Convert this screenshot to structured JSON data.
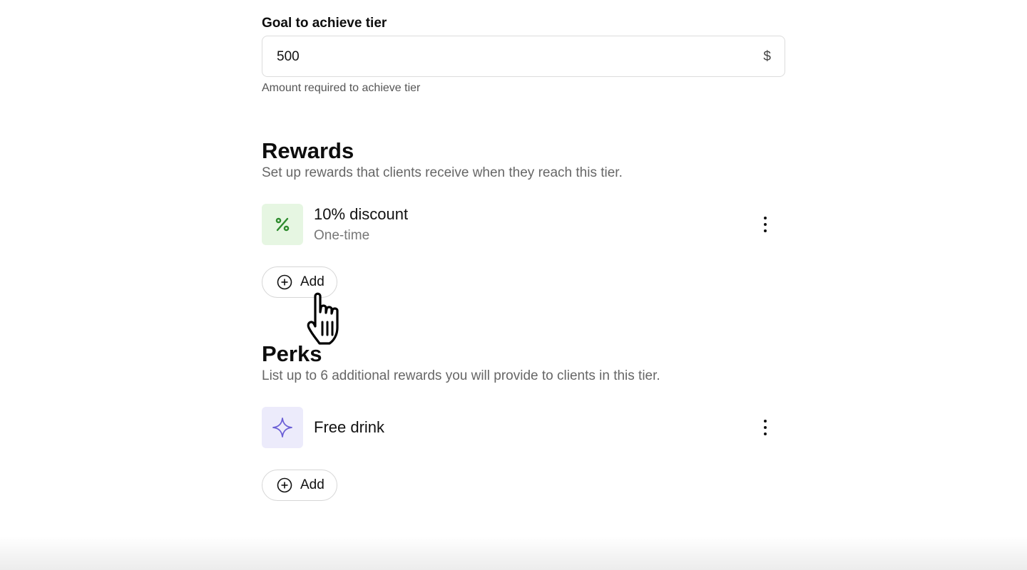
{
  "goal": {
    "label": "Goal to achieve tier",
    "value": "500",
    "currency_symbol": "$",
    "helper": "Amount required to achieve tier"
  },
  "rewards": {
    "title": "Rewards",
    "description": "Set up rewards that clients receive when they reach this tier.",
    "items": [
      {
        "title": "10% discount",
        "subtitle": "One-time",
        "icon": "percent-icon",
        "icon_color": "#2e8b2e",
        "icon_bg": "#e6f6e2"
      }
    ],
    "add_label": "Add"
  },
  "perks": {
    "title": "Perks",
    "description": "List up to 6 additional rewards you will provide to clients in this tier.",
    "items": [
      {
        "title": "Free drink",
        "icon": "sparkle-icon",
        "icon_color": "#6b5fd6",
        "icon_bg": "#ecebfb"
      }
    ],
    "add_label": "Add"
  }
}
